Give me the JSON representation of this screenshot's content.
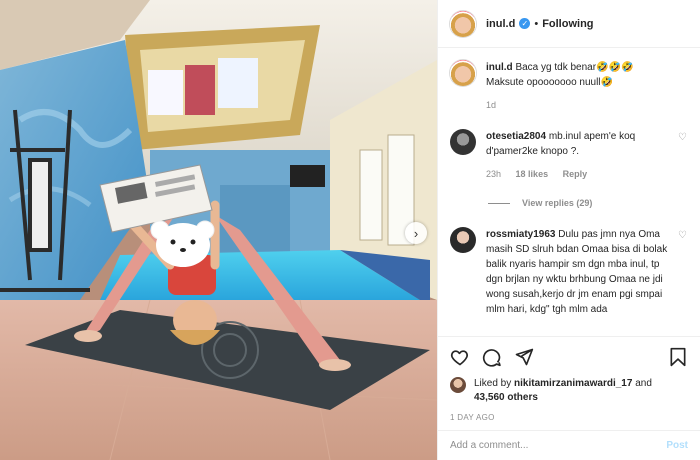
{
  "header": {
    "username": "inul.d",
    "verified_icon": "verified-badge-icon",
    "separator": "•",
    "follow_status": "Following"
  },
  "caption": {
    "username": "inul.d",
    "text": "Baca yg tdk benar🤣🤣🤣 Maksute opooooooo nuull🤣",
    "time": "1d"
  },
  "comments": [
    {
      "username": "otesetia2804",
      "text": "mb.inul apem'e koq d'pamer2ke knopo ?.",
      "time": "23h",
      "likes": "18 likes",
      "reply": "Reply"
    },
    {
      "username": "rossmiaty1963",
      "text": "Dulu pas jmn nya Oma masih SD slruh bdan Omaa bisa di bolak balik nyaris hampir sm dgn mba inul, tp dgn brjlan ny wktu brhbung Omaa ne jdi wong susah,kerjo dr jm enam pgi smpai mlm hari, kdg\" tgh mlm ada"
    }
  ],
  "view_replies": "View replies (29)",
  "likes": {
    "prefix": "Liked by",
    "user": "nikitamirzanimawardi_17",
    "connector": "and",
    "count": "43,560 others"
  },
  "time_ago": "1 DAY AGO",
  "add_comment": {
    "placeholder": "Add a comment...",
    "post_label": "Post"
  },
  "icons": {
    "like": "heart-icon",
    "comment": "comment-icon",
    "share": "share-icon",
    "save": "bookmark-icon",
    "next": "chevron-right-icon"
  },
  "colors": {
    "accent": "#3897f0",
    "post_disabled": "#b2dffc",
    "muted": "#8e8e8e"
  }
}
